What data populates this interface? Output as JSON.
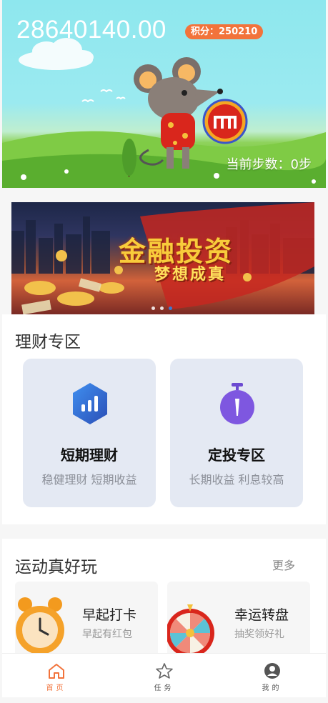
{
  "hero": {
    "balance": "28640140.00",
    "points_label": "积分：250210",
    "steps_label": "当前步数：0步"
  },
  "banner": {
    "headline": "金融投资",
    "subline": "梦想成真",
    "slides": 3,
    "active_slide": 3
  },
  "finance": {
    "title": "理财专区",
    "cards": [
      {
        "title": "短期理财",
        "sub": "稳健理财 短期收益",
        "icon": "bar-chart-hexagon-icon"
      },
      {
        "title": "定投专区",
        "sub": "长期收益 利息较高",
        "icon": "stopwatch-icon"
      }
    ]
  },
  "sports": {
    "title": "运动真好玩",
    "more": "更多",
    "cards": [
      {
        "title": "早起打卡",
        "sub": "早起有红包",
        "icon": "alarm-clock-icon"
      },
      {
        "title": "幸运转盘",
        "sub": "抽奖领好礼",
        "icon": "prize-wheel-icon"
      }
    ]
  },
  "tabbar": {
    "items": [
      {
        "label": "首页",
        "icon": "home-icon",
        "active": true
      },
      {
        "label": "任务",
        "icon": "star-icon",
        "active": false
      },
      {
        "label": "我的",
        "icon": "user-icon",
        "active": false
      }
    ]
  },
  "colors": {
    "accent": "#f2733b",
    "sky": "#8ee7ee",
    "card_bg": "#e4e9f3",
    "active_dot": "#3a7bd5"
  }
}
